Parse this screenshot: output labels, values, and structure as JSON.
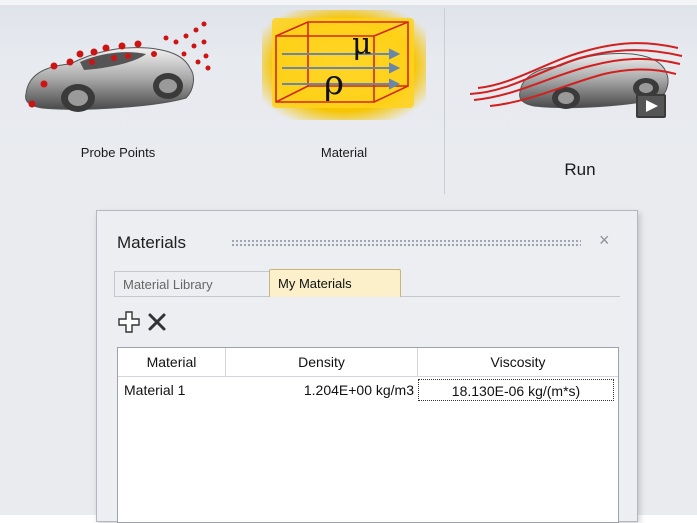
{
  "ribbon": {
    "tools": [
      {
        "label": "Probe Points"
      },
      {
        "label": "Material"
      },
      {
        "label": "Run"
      }
    ],
    "material_icon_symbols": {
      "rho": "ρ",
      "mu": "μ"
    }
  },
  "materials_panel": {
    "title": "Materials",
    "close_glyph": "×",
    "tabs": [
      {
        "label": "Material Library",
        "active": false
      },
      {
        "label": "My Materials",
        "active": true
      }
    ],
    "toolbar": {
      "add_icon": "add-icon",
      "delete_icon": "delete-icon"
    },
    "table": {
      "columns": [
        "Material",
        "Density",
        "Viscosity"
      ],
      "rows": [
        {
          "material": "Material 1",
          "density": "1.204E+00 kg/m3",
          "viscosity": "18.130E-06 kg/(m*s)"
        }
      ]
    }
  },
  "colors": {
    "ribbon_bg": "#e9ebef",
    "active_tab": "#fbf0c9",
    "highlight_glow": "#f3c200",
    "probe_red": "#d01818"
  }
}
